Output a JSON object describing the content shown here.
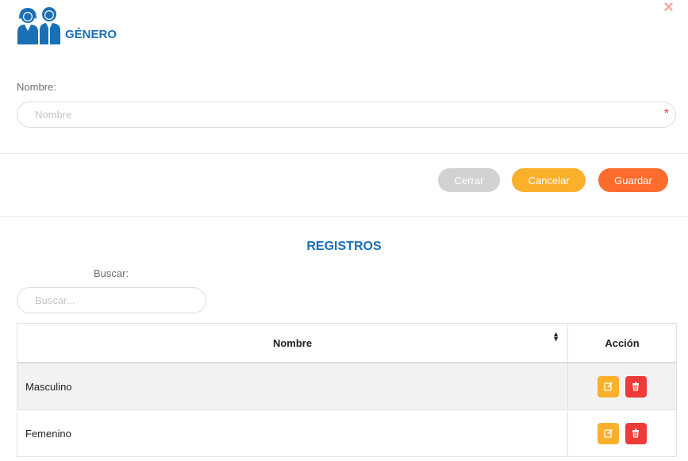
{
  "header": {
    "title": "GÉNERO",
    "logo_icon": "two-people-icon",
    "close_icon": "close-x-icon",
    "close_glyph": "×",
    "accent_color": "#1a6fb5"
  },
  "form": {
    "name_label": "Nombre:",
    "name_placeholder": "Nombre",
    "name_value": "",
    "required_mark": "*"
  },
  "buttons": {
    "close_label": "Cerrar",
    "cancel_label": "Cancelar",
    "save_label": "Guardar",
    "close_color": "#d2d2d2",
    "cancel_color": "#fbb02c",
    "save_color": "#fd6b2d"
  },
  "records": {
    "title": "REGISTROS",
    "search_label": "Buscar:",
    "search_placeholder": "Buscar...",
    "columns": [
      "Nombre",
      "Acción"
    ],
    "sort_icon": "sort-icon",
    "rows": [
      {
        "nombre": "Masculino"
      },
      {
        "nombre": "Femenino"
      }
    ],
    "row_actions": [
      "edit-icon",
      "trash-icon"
    ]
  }
}
